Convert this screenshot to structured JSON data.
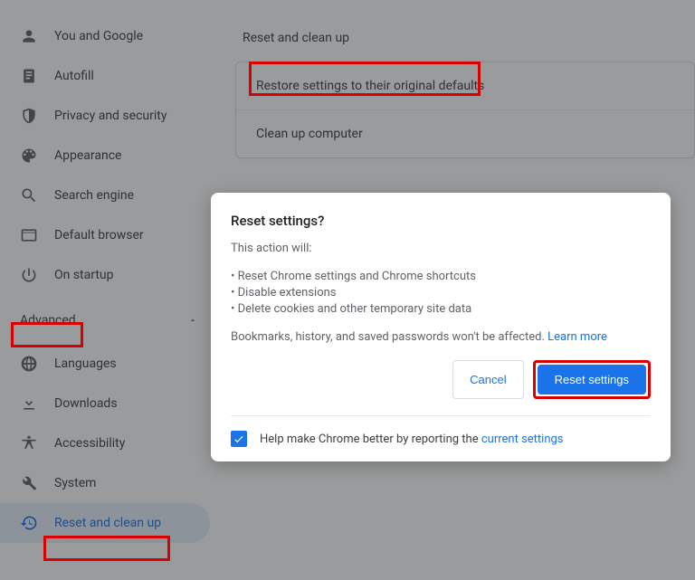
{
  "sidebar": {
    "items": [
      {
        "label": "You and Google",
        "icon": "person"
      },
      {
        "label": "Autofill",
        "icon": "autofill"
      },
      {
        "label": "Privacy and security",
        "icon": "shield"
      },
      {
        "label": "Appearance",
        "icon": "palette"
      },
      {
        "label": "Search engine",
        "icon": "search"
      },
      {
        "label": "Default browser",
        "icon": "browser"
      },
      {
        "label": "On startup",
        "icon": "power"
      }
    ],
    "advanced_label": "Advanced",
    "advanced_items": [
      {
        "label": "Languages",
        "icon": "globe"
      },
      {
        "label": "Downloads",
        "icon": "download"
      },
      {
        "label": "Accessibility",
        "icon": "accessibility"
      },
      {
        "label": "System",
        "icon": "wrench"
      },
      {
        "label": "Reset and clean up",
        "icon": "restore",
        "active": true
      }
    ]
  },
  "main": {
    "section_title": "Reset and clean up",
    "rows": [
      "Restore settings to their original defaults",
      "Clean up computer"
    ]
  },
  "dialog": {
    "title": "Reset settings?",
    "subtitle": "This action will:",
    "bullets": [
      "Reset Chrome settings and Chrome shortcuts",
      "Disable extensions",
      "Delete cookies and other temporary site data"
    ],
    "note_prefix": "Bookmarks, history, and saved passwords won't be affected. ",
    "note_link": "Learn more",
    "cancel_label": "Cancel",
    "confirm_label": "Reset settings",
    "footer_prefix": "Help make Chrome better by reporting the ",
    "footer_link": "current settings",
    "checkbox_checked": true
  },
  "highlights": {
    "advanced": true,
    "reset_and_clean_up": true,
    "restore_defaults": true,
    "reset_button": true
  }
}
